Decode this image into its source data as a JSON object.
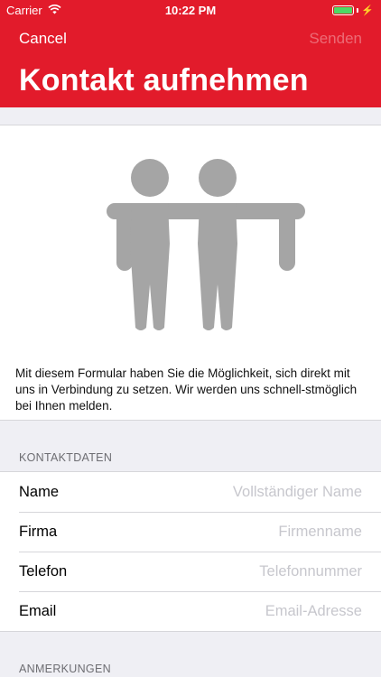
{
  "status_bar": {
    "carrier": "Carrier",
    "time": "10:22 PM"
  },
  "nav": {
    "cancel_label": "Cancel",
    "send_label": "Senden",
    "title": "Kontakt aufnehmen"
  },
  "intro": {
    "icon": "people-icon",
    "text": "Mit diesem Formular haben Sie die Möglichkeit, sich direkt mit uns in Verbindung zu setzen. Wir werden uns schnell-stmöglich bei Ihnen melden."
  },
  "contact_section": {
    "header": "KONTAKTDATEN",
    "fields": [
      {
        "label": "Name",
        "value": "",
        "placeholder": "Vollständiger Name"
      },
      {
        "label": "Firma",
        "value": "",
        "placeholder": "Firmenname"
      },
      {
        "label": "Telefon",
        "value": "",
        "placeholder": "Telefonnummer"
      },
      {
        "label": "Email",
        "value": "",
        "placeholder": "Email-Adresse"
      }
    ]
  },
  "notes_section": {
    "header": "ANMERKUNGEN"
  },
  "colors": {
    "brand_red": "#e21b2b",
    "background": "#efeff4",
    "placeholder": "#c7c7cd",
    "icon_gray": "#a5a5a5"
  }
}
